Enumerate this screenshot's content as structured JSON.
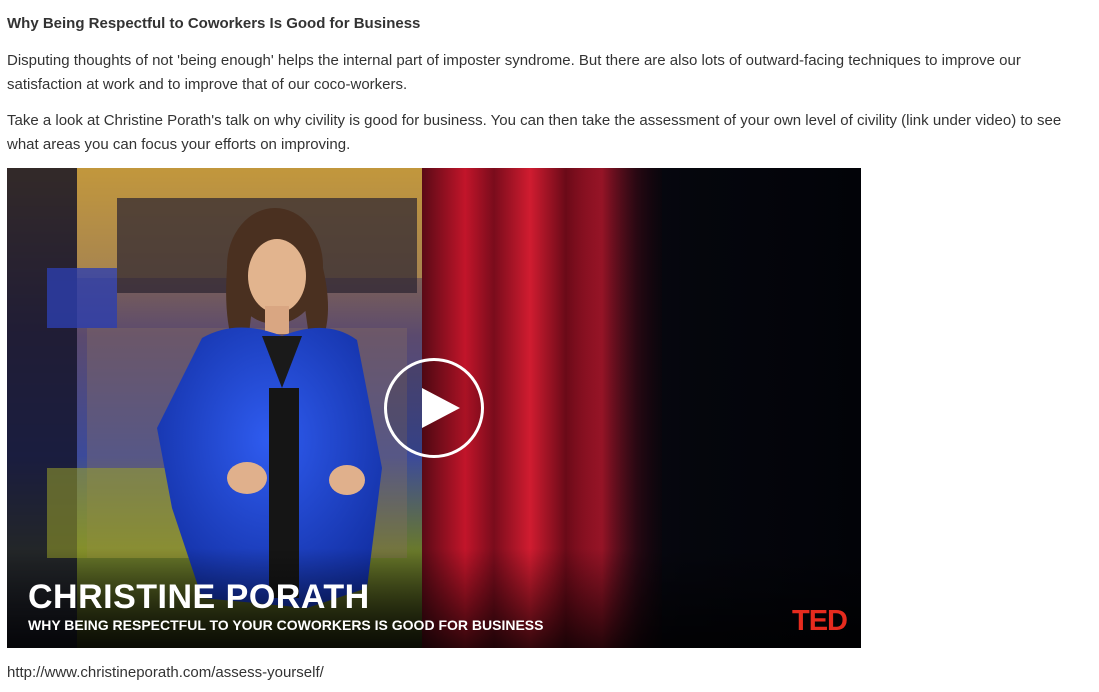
{
  "article": {
    "heading": "Why Being Respectful to Coworkers Is Good for Business",
    "paragraph1": "Disputing thoughts of not 'being enough' helps the internal part of imposter syndrome. But there are also lots of outward-facing techniques to improve our satisfaction at work and to improve that of our coco-workers.",
    "paragraph2": "Take a look at Christine Porath's talk on why civility is good for business. You can then take the assessment of your own level of civility (link under video) to see what areas you can focus your efforts on improving.",
    "link_text": "http://www.christineporath.com/assess-yourself/"
  },
  "video": {
    "speaker_name": "CHRISTINE PORATH",
    "talk_title": "WHY BEING RESPECTFUL TO YOUR COWORKERS IS GOOD FOR BUSINESS",
    "brand": "TED",
    "play_icon": "play-icon",
    "colors": {
      "ted_red": "#e62b1e",
      "curtain_red": "#c2152a",
      "jacket_blue": "#1a3fc4",
      "background": "#06070c"
    }
  }
}
